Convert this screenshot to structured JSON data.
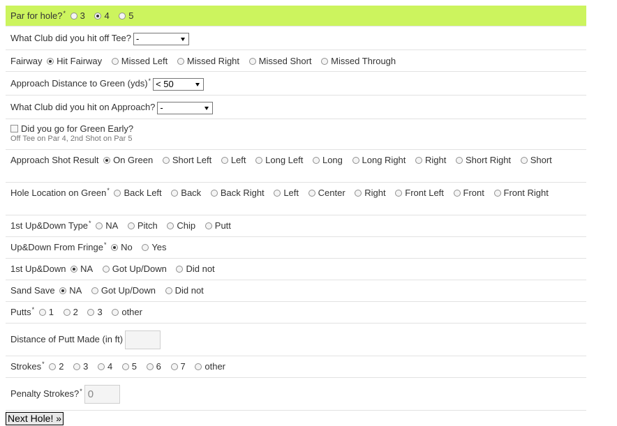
{
  "rows": [
    {
      "label": "Par for hole?",
      "required": true,
      "highlight": true,
      "type": "radio",
      "options": [
        {
          "label": "3",
          "checked": false
        },
        {
          "label": "4",
          "checked": true
        },
        {
          "label": "5",
          "checked": false
        }
      ]
    },
    {
      "label": "What Club did you hit off Tee?",
      "required": false,
      "type": "select",
      "value": "-"
    },
    {
      "label": "Fairway",
      "required": false,
      "type": "radio",
      "options": [
        {
          "label": "Hit Fairway",
          "checked": true
        },
        {
          "label": "Missed Left",
          "checked": false
        },
        {
          "label": "Missed Right",
          "checked": false
        },
        {
          "label": "Missed Short",
          "checked": false
        },
        {
          "label": "Missed Through",
          "checked": false
        }
      ]
    },
    {
      "label": "Approach Distance to Green (yds)",
      "required": true,
      "type": "select",
      "value": "< 50"
    },
    {
      "label": "What Club did you hit on Approach?",
      "required": false,
      "type": "select",
      "value": "-"
    },
    {
      "label": "Did you go for Green Early?",
      "required": false,
      "type": "checkbox",
      "checked": false,
      "note": "Off Tee on Par 4, 2nd Shot on Par 5"
    },
    {
      "label": "Approach Shot Result",
      "required": false,
      "type": "radio",
      "options": [
        {
          "label": "On Green",
          "checked": true
        },
        {
          "label": "Short Left",
          "checked": false
        },
        {
          "label": "Left",
          "checked": false
        },
        {
          "label": "Long Left",
          "checked": false
        },
        {
          "label": "Long",
          "checked": false
        },
        {
          "label": "Long Right",
          "checked": false
        },
        {
          "label": "Right",
          "checked": false
        },
        {
          "label": "Short Right",
          "checked": false
        },
        {
          "label": "Short",
          "checked": false
        }
      ]
    },
    {
      "label": "Hole Location on Green",
      "required": true,
      "type": "radio",
      "options": [
        {
          "label": "Back Left",
          "checked": false
        },
        {
          "label": "Back",
          "checked": false
        },
        {
          "label": "Back Right",
          "checked": false
        },
        {
          "label": "Left",
          "checked": false
        },
        {
          "label": "Center",
          "checked": false
        },
        {
          "label": "Right",
          "checked": false
        },
        {
          "label": "Front Left",
          "checked": false
        },
        {
          "label": "Front",
          "checked": false
        },
        {
          "label": "Front Right",
          "checked": false
        }
      ]
    },
    {
      "label": "1st Up&Down Type",
      "required": true,
      "type": "radio",
      "options": [
        {
          "label": "NA",
          "checked": false
        },
        {
          "label": "Pitch",
          "checked": false
        },
        {
          "label": "Chip",
          "checked": false
        },
        {
          "label": "Putt",
          "checked": false
        }
      ]
    },
    {
      "label": "Up&Down From Fringe",
      "required": true,
      "type": "radio",
      "options": [
        {
          "label": "No",
          "checked": true
        },
        {
          "label": "Yes",
          "checked": false
        }
      ]
    },
    {
      "label": "1st Up&Down",
      "required": false,
      "type": "radio",
      "options": [
        {
          "label": "NA",
          "checked": true
        },
        {
          "label": "Got Up/Down",
          "checked": false
        },
        {
          "label": "Did not",
          "checked": false
        }
      ]
    },
    {
      "label": "Sand Save",
      "required": false,
      "type": "radio",
      "options": [
        {
          "label": "NA",
          "checked": true
        },
        {
          "label": "Got Up/Down",
          "checked": false
        },
        {
          "label": "Did not",
          "checked": false
        }
      ]
    },
    {
      "label": "Putts",
      "required": true,
      "type": "radio",
      "options": [
        {
          "label": "1",
          "checked": false
        },
        {
          "label": "2",
          "checked": false
        },
        {
          "label": "3",
          "checked": false
        },
        {
          "label": "other",
          "checked": false
        }
      ]
    },
    {
      "label": "Distance of Putt Made (in ft)",
      "required": false,
      "type": "text",
      "value": ""
    },
    {
      "label": "Strokes",
      "required": true,
      "type": "radio",
      "options": [
        {
          "label": "2",
          "checked": false
        },
        {
          "label": "3",
          "checked": false
        },
        {
          "label": "4",
          "checked": false
        },
        {
          "label": "5",
          "checked": false
        },
        {
          "label": "6",
          "checked": false
        },
        {
          "label": "7",
          "checked": false
        },
        {
          "label": "other",
          "checked": false
        }
      ]
    },
    {
      "label": "Penalty Strokes?",
      "required": true,
      "type": "text",
      "value": "0"
    }
  ],
  "required_marker": "*",
  "submit_label": "Next Hole! »",
  "colors": {
    "highlight": "#ccf45e",
    "divider": "#e2e2e2",
    "text": "#333333"
  }
}
